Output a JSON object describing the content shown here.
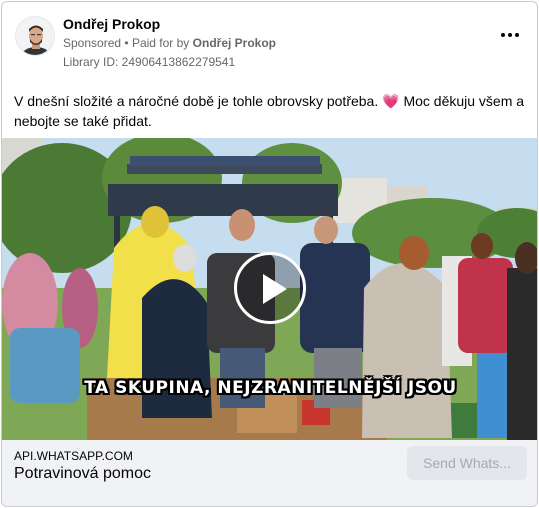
{
  "header": {
    "author_name": "Ondřej Prokop",
    "sponsored_label": "Sponsored",
    "separator": "•",
    "paid_for_prefix": "Paid for by",
    "paid_for_name": "Ondřej Prokop",
    "library_id": "Library ID: 24906413862279541",
    "more_icon": "more-horizontal-icon"
  },
  "post": {
    "text_before_emoji": "V dnešní složité a náročné době je tohle obrovsky potřeba.",
    "emoji": "💗",
    "text_after_emoji": " Moc děkuju všem a nebojte se také přidat."
  },
  "media": {
    "caption": "TA SKUPINA, NEJZRANITELNĚJŠÍ JSOU",
    "play_icon": "play-icon"
  },
  "footer": {
    "domain": "API.WHATSAPP.COM",
    "title": "Potravinová pomoc",
    "cta_label": "Send Whats..."
  },
  "colors": {
    "secondary_text": "#65676b",
    "footer_bg": "#f0f2f5",
    "cta_bg": "#e4e6eb",
    "heart": "#e0457b"
  }
}
